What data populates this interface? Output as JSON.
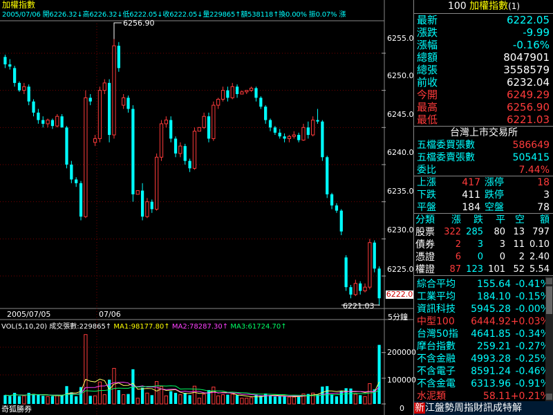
{
  "chart": {
    "title": "加權指數",
    "header_line": "2005/07/06 開6226.32↓高6226.32↓低6222.05↓收6222.05↓量229865↑額538118↑換0.00% 振0.07% 漲",
    "high_annotation": "6256.90",
    "low_annotation": "6221.03",
    "current_price_tag": "6222.0",
    "price_ticks": [
      "6255.0",
      "6250.0",
      "6245.0",
      "6240.0",
      "6235.0",
      "6230.0",
      "6225.0"
    ],
    "date_left": "2005/07/05",
    "date_mid": "07/06",
    "interval_label": "5分鐘",
    "vol_header": {
      "vol": "VOL(5,10,20) 成交張數:229865↑",
      "ma1": "MA1:98177.80↑",
      "ma2": "MA2:78287.30↑",
      "ma3": "MA3:61724.70↑"
    },
    "vol_ticks": [
      "200000",
      "100000",
      "0"
    ],
    "watermark": "奇狐勝券"
  },
  "chart_data": {
    "type": "candlestick",
    "title": "加權指數",
    "ylim": [
      6221,
      6259
    ],
    "candles": [
      [
        6254.5,
        6254.8,
        6253.0,
        6253.5
      ],
      [
        6253.5,
        6254.2,
        6252.8,
        6253.2
      ],
      [
        6253.0,
        6253.3,
        6250.5,
        6251.0
      ],
      [
        6251.0,
        6251.2,
        6249.8,
        6250.0
      ],
      [
        6250.0,
        6251.0,
        6249.5,
        6250.5
      ],
      [
        6250.5,
        6250.8,
        6248.0,
        6248.5
      ],
      [
        6248.5,
        6248.8,
        6246.5,
        6247.0
      ],
      [
        6247.0,
        6247.5,
        6245.5,
        6246.0
      ],
      [
        6246.0,
        6246.5,
        6245.0,
        6245.5
      ],
      [
        6245.5,
        6246.2,
        6245.0,
        6246.0
      ],
      [
        6246.0,
        6246.2,
        6244.8,
        6245.2
      ],
      [
        6245.2,
        6246.8,
        6245.0,
        6246.5
      ],
      [
        6246.5,
        6246.8,
        6245.0,
        6245.0
      ],
      [
        6245.0,
        6245.2,
        6239.5,
        6240.0
      ],
      [
        6240.0,
        6240.5,
        6237.5,
        6238.0
      ],
      [
        6238.0,
        6238.3,
        6237.0,
        6237.5
      ],
      [
        6237.5,
        6237.8,
        6232.5,
        6233.0
      ],
      [
        6233.0,
        6250.0,
        6232.8,
        6249.0
      ],
      [
        6249.0,
        6249.5,
        6248.0,
        6248.5
      ],
      [
        6243.0,
        6244.0,
        6242.5,
        6243.5
      ],
      [
        6243.5,
        6250.5,
        6243.0,
        6250.0
      ],
      [
        6250.0,
        6251.5,
        6249.5,
        6251.0
      ],
      [
        6251.0,
        6251.5,
        6243.0,
        6244.0
      ],
      [
        6244.0,
        6256.9,
        6243.5,
        6256.0
      ],
      [
        6256.0,
        6256.5,
        6252.5,
        6253.0
      ],
      [
        6248.0,
        6249.5,
        6247.5,
        6249.0
      ],
      [
        6249.0,
        6249.3,
        6247.0,
        6247.5
      ],
      [
        6247.5,
        6248.0,
        6235.0,
        6236.0
      ],
      [
        6236.0,
        6236.5,
        6236.0,
        6236.5
      ],
      [
        6236.5,
        6237.5,
        6232.5,
        6233.0
      ],
      [
        6233.0,
        6235.5,
        6232.8,
        6235.0
      ],
      [
        6235.0,
        6235.3,
        6233.5,
        6234.0
      ],
      [
        6234.0,
        6241.5,
        6233.8,
        6241.0
      ],
      [
        6241.0,
        6246.0,
        6240.5,
        6245.5
      ],
      [
        6245.5,
        6246.5,
        6245.0,
        6246.0
      ],
      [
        6246.0,
        6246.5,
        6243.0,
        6243.5
      ],
      [
        6243.5,
        6243.8,
        6241.0,
        6241.5
      ],
      [
        6241.5,
        6243.0,
        6241.0,
        6242.5
      ],
      [
        6242.5,
        6242.8,
        6240.0,
        6240.5
      ],
      [
        6240.5,
        6240.8,
        6239.0,
        6239.5
      ],
      [
        6239.5,
        6245.0,
        6239.3,
        6244.5
      ],
      [
        6244.5,
        6245.0,
        6244.5,
        6245.0
      ],
      [
        6245.0,
        6247.0,
        6244.8,
        6246.5
      ],
      [
        6246.5,
        6247.0,
        6243.0,
        6243.5
      ],
      [
        6243.5,
        6248.5,
        6243.2,
        6248.0
      ],
      [
        6248.0,
        6249.0,
        6247.5,
        6248.8
      ],
      [
        6248.8,
        6250.5,
        6248.5,
        6250.0
      ],
      [
        6250.0,
        6250.5,
        6248.5,
        6249.0
      ],
      [
        6249.0,
        6251.0,
        6248.8,
        6250.5
      ],
      [
        6250.5,
        6250.8,
        6249.0,
        6249.5
      ],
      [
        6249.5,
        6250.0,
        6249.5,
        6249.8
      ],
      [
        6249.8,
        6250.0,
        6249.5,
        6250.0
      ],
      [
        6250.0,
        6250.5,
        6249.8,
        6250.3
      ],
      [
        6250.3,
        6250.5,
        6248.5,
        6249.0
      ],
      [
        6249.0,
        6249.2,
        6247.5,
        6247.8
      ],
      [
        6247.8,
        6248.0,
        6245.5,
        6246.0
      ],
      [
        6246.0,
        6246.2,
        6244.5,
        6245.0
      ],
      [
        6245.0,
        6245.2,
        6244.0,
        6244.3
      ],
      [
        6244.3,
        6244.8,
        6243.5,
        6243.8
      ],
      [
        6243.8,
        6244.2,
        6243.0,
        6243.5
      ],
      [
        6243.5,
        6244.0,
        6243.0,
        6243.8
      ],
      [
        6243.8,
        6244.5,
        6243.5,
        6244.0
      ],
      [
        6244.0,
        6244.3,
        6243.0,
        6243.3
      ],
      [
        6243.3,
        6245.5,
        6243.2,
        6245.0
      ],
      [
        6245.0,
        6245.8,
        6243.5,
        6244.0
      ],
      [
        6244.0,
        6246.5,
        6243.8,
        6246.0
      ],
      [
        6246.0,
        6247.5,
        6245.5,
        6245.8
      ],
      [
        6245.8,
        6246.0,
        6240.5,
        6241.0
      ],
      [
        6241.0,
        6241.2,
        6235.5,
        6236.0
      ],
      [
        6236.0,
        6236.2,
        6234.0,
        6234.5
      ],
      [
        6234.5,
        6234.8,
        6233.5,
        6233.8
      ],
      [
        6233.8,
        6234.0,
        6230.5,
        6231.0
      ],
      [
        6227.5,
        6227.8,
        6223.0,
        6223.5
      ],
      [
        6223.5,
        6223.8,
        6222.0,
        6222.5
      ],
      [
        6222.5,
        6224.5,
        6222.3,
        6224.0
      ],
      [
        6224.0,
        6224.3,
        6222.5,
        6223.0
      ],
      [
        6223.0,
        6224.0,
        6222.8,
        6223.5
      ],
      [
        6223.5,
        6230.0,
        6223.2,
        6229.5
      ],
      [
        6229.5,
        6229.8,
        6225.5,
        6226.0
      ],
      [
        6226.0,
        6226.3,
        6221.0,
        6222.0
      ]
    ],
    "x_labels": [
      "2005/07/05",
      "07/06"
    ],
    "volume": {
      "ylim": [
        0,
        280000
      ],
      "ticks": [
        0,
        100000,
        200000
      ],
      "ma_labels": [
        "MA1",
        "MA2",
        "MA3"
      ]
    }
  },
  "quote": {
    "code": "100",
    "name": "加權指數",
    "suffix": "(1)",
    "rows": [
      {
        "label": "最新",
        "value": "6222.05",
        "color": "#00ffff"
      },
      {
        "label": "漲跌",
        "value": "-9.99",
        "color": "#00ffff"
      },
      {
        "label": "漲幅",
        "value": "-0.16%",
        "color": "#00ffff"
      },
      {
        "label": "總額",
        "value": "8047901",
        "color": "#ffffff"
      },
      {
        "label": "總張",
        "value": "3558579",
        "color": "#ffffff"
      },
      {
        "label": "前收",
        "value": "6232.04",
        "color": "#ffffff"
      },
      {
        "label": "今開",
        "value": "6249.29",
        "color": "#ff3b3b",
        "label_color": "#ff3b3b"
      },
      {
        "label": "最高",
        "value": "6256.90",
        "color": "#ff3b3b",
        "label_color": "#ff3b3b"
      },
      {
        "label": "最低",
        "value": "6221.03",
        "color": "#ff3b3b",
        "label_color": "#ff3b3b"
      }
    ]
  },
  "exchange": {
    "title": "台灣上市交易所",
    "rows": [
      {
        "label": "五檔委買張數",
        "value": "586649",
        "color": "#ff3b3b"
      },
      {
        "label": "五檔委賣張數",
        "value": "505415",
        "color": "#00ffff"
      },
      {
        "label": "委比",
        "value": "7.44%",
        "color": "#ff3b3b"
      }
    ],
    "stats": [
      {
        "l1": "上漲",
        "v1": "417",
        "l2": "漲停",
        "v2": "18",
        "c1": "#ff3b3b",
        "c2": "#ff3b3b"
      },
      {
        "l1": "下跌",
        "v1": "411",
        "l2": "跌停",
        "v2": "3",
        "c1": "#ffffff",
        "c2": "#ffffff"
      },
      {
        "l1": "平盤",
        "v1": "184",
        "l2": "空盤",
        "v2": "78",
        "c1": "#ffffff",
        "c2": "#ffffff"
      }
    ]
  },
  "breadth": {
    "headers": [
      "分類",
      "漲",
      "跌",
      "平",
      "空",
      "額"
    ],
    "rows": [
      {
        "name": "股票",
        "up": "322",
        "down": "285",
        "flat": "80",
        "empty": "13",
        "amt": "797"
      },
      {
        "name": "債券",
        "up": "2",
        "down": "3",
        "flat": "3",
        "empty": "11",
        "amt": "0.10"
      },
      {
        "name": "憑證",
        "up": "6",
        "down": "0",
        "flat": "0",
        "empty": "2",
        "amt": "2.40"
      },
      {
        "name": "權證",
        "up": "87",
        "down": "123",
        "flat": "101",
        "empty": "52",
        "amt": "5.54"
      }
    ]
  },
  "indices": [
    {
      "name": "綜合平均",
      "value": "155.64",
      "pct": "-0.41%",
      "name_color": "#00ffff",
      "value_color": "#00ffff",
      "pct_color": "#00ffff"
    },
    {
      "name": "工業平均",
      "value": "184.10",
      "pct": "-0.15%",
      "name_color": "#00ffff",
      "value_color": "#00ffff",
      "pct_color": "#00ffff"
    },
    {
      "name": "資訊科技",
      "value": "5945.28",
      "pct": "-0.00%",
      "name_color": "#00ffff",
      "value_color": "#00ffff",
      "pct_color": "#00ffff"
    },
    {
      "name": "中型100",
      "value": "6444.92",
      "pct": "+0.03%",
      "name_color": "#ff3b3b",
      "value_color": "#ff3b3b",
      "pct_color": "#ff3b3b"
    },
    {
      "name": "台灣50指",
      "value": "4641.85",
      "pct": "-0.34%",
      "name_color": "#00ffff",
      "value_color": "#00ffff",
      "pct_color": "#00ffff"
    },
    {
      "name": "摩台指數",
      "value": "259.21",
      "pct": "-0.27%",
      "name_color": "#00ffff",
      "value_color": "#00ffff",
      "pct_color": "#00ffff"
    },
    {
      "name": "不含金融",
      "value": "4993.28",
      "pct": "-0.25%",
      "name_color": "#00ffff",
      "value_color": "#00ffff",
      "pct_color": "#00ffff"
    },
    {
      "name": "不含電子",
      "value": "8591.24",
      "pct": "-0.46%",
      "name_color": "#00ffff",
      "value_color": "#00ffff",
      "pct_color": "#00ffff"
    },
    {
      "name": "不含金電",
      "value": "6313.96",
      "pct": "-0.91%",
      "name_color": "#00ffff",
      "value_color": "#00ffff",
      "pct_color": "#00ffff"
    },
    {
      "name": "水泥類",
      "value": "58.11",
      "pct": "+0.21%",
      "name_color": "#ff3b3b",
      "value_color": "#ff3b3b",
      "pct_color": "#ff3b3b"
    }
  ],
  "footer": {
    "badge": "新",
    "text": "江盤勢周指財訊成特解"
  },
  "colors": {
    "up": "#ff3b3b",
    "down": "#00ffff",
    "grid": "#7a0000",
    "ma1": "#ffff66",
    "ma2": "#ff40ff",
    "ma3": "#00ff66"
  }
}
